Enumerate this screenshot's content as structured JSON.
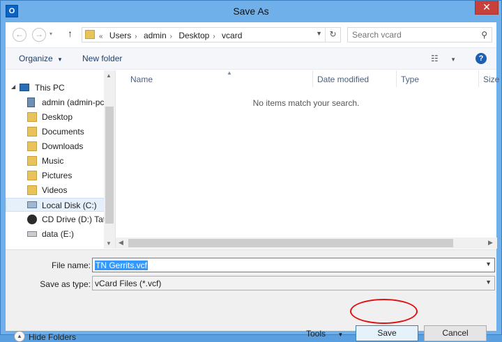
{
  "window": {
    "title": "Save As",
    "app_icon_text": "O",
    "close_glyph": "✕"
  },
  "nav": {
    "back_glyph": "←",
    "forward_glyph": "→",
    "up_glyph": "↑",
    "overflow": "«",
    "breadcrumbs": [
      "Users",
      "admin",
      "Desktop",
      "vcard"
    ],
    "refresh_glyph": "↻",
    "search_placeholder": "Search vcard"
  },
  "toolbar": {
    "organize_label": "Organize",
    "new_folder_label": "New folder",
    "help_glyph": "?"
  },
  "sidebar": {
    "items": [
      {
        "label": "This PC",
        "icon": "computer-icon"
      },
      {
        "label": "admin (admin-pc",
        "icon": "network-drive-icon"
      },
      {
        "label": "Desktop",
        "icon": "folder-icon"
      },
      {
        "label": "Documents",
        "icon": "folder-icon"
      },
      {
        "label": "Downloads",
        "icon": "folder-icon"
      },
      {
        "label": "Music",
        "icon": "folder-icon"
      },
      {
        "label": "Pictures",
        "icon": "folder-icon"
      },
      {
        "label": "Videos",
        "icon": "folder-icon"
      },
      {
        "label": "Local Disk (C:)",
        "icon": "disk-icon"
      },
      {
        "label": "CD Drive (D:) Tat",
        "icon": "cd-icon"
      },
      {
        "label": "data (E:)",
        "icon": "drive-icon"
      }
    ]
  },
  "files": {
    "columns": [
      "Name",
      "Date modified",
      "Type",
      "Size"
    ],
    "empty_message": "No items match your search."
  },
  "form": {
    "file_name_label": "File name:",
    "file_name_value": "TN Gerrits.vcf",
    "save_type_label": "Save as type:",
    "save_type_value": "vCard Files (*.vcf)"
  },
  "footer": {
    "hide_folders_label": "Hide Folders",
    "tools_label": "Tools",
    "save_label": "Save",
    "cancel_label": "Cancel"
  },
  "colors": {
    "title_bar": "#6fb0ea",
    "close": "#c7413a",
    "highlight_ring": "#e01010"
  }
}
